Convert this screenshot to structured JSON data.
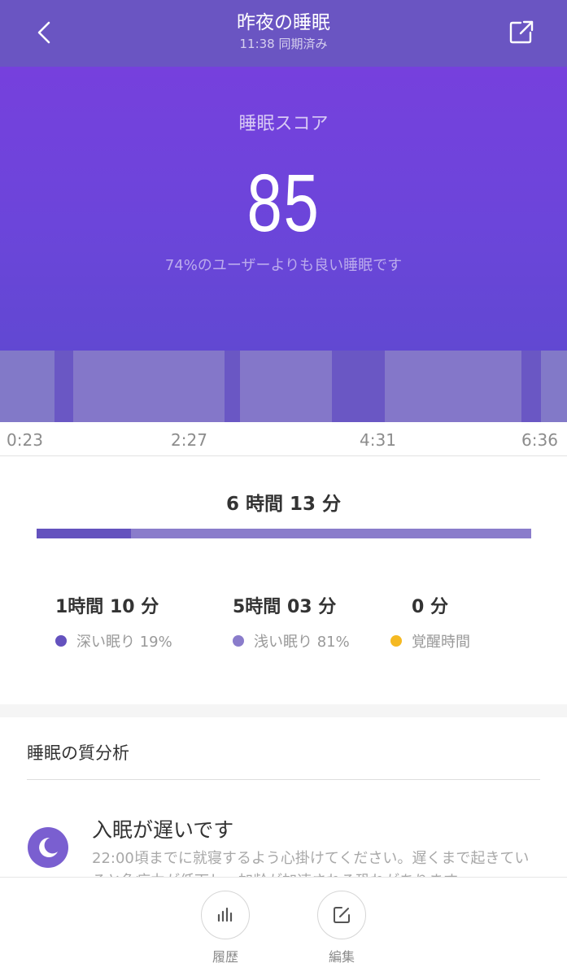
{
  "header": {
    "title": "昨夜の睡眠",
    "subtitle": "11:38 同期済み",
    "back_icon": "chevron-left-icon",
    "share_icon": "share-export-icon"
  },
  "score": {
    "label": "睡眠スコア",
    "value": "85",
    "caption": "74%のユーザーよりも良い睡眠です"
  },
  "timeline": {
    "ticks": [
      "0:23",
      "2:27",
      "4:31",
      "6:36"
    ],
    "colors": {
      "deep": "#6a57c4",
      "light": "#8477c9"
    }
  },
  "summary": {
    "total": "6 時間 13 分",
    "deep_fraction": 0.19
  },
  "stats": [
    {
      "value": "1時間 10 分",
      "legend": "深い眠り 19%",
      "color": "#6452be"
    },
    {
      "value": "5時間 03 分",
      "legend": "浅い眠り 81%",
      "color": "#8a7ccb"
    },
    {
      "value": "0  分",
      "legend": "覚醒時間",
      "color": "#f5b922"
    }
  ],
  "analysis": {
    "title": "睡眠の質分析",
    "insight": {
      "icon": "moon-icon",
      "title": "入眠が遅いです",
      "body": "22:00頃までに就寝するよう心掛けてください。遅くまで起きていると免疫力が低下し、加齢が加速される恐れがあります。"
    }
  },
  "bottom_nav": [
    {
      "label": "履歴",
      "icon": "bar-chart-icon"
    },
    {
      "label": "編集",
      "icon": "edit-icon"
    }
  ],
  "colors": {
    "header": "#6a55c2",
    "hero_top": "#7640dd",
    "hero_bottom": "#6148d2",
    "awake": "#f5b922"
  }
}
